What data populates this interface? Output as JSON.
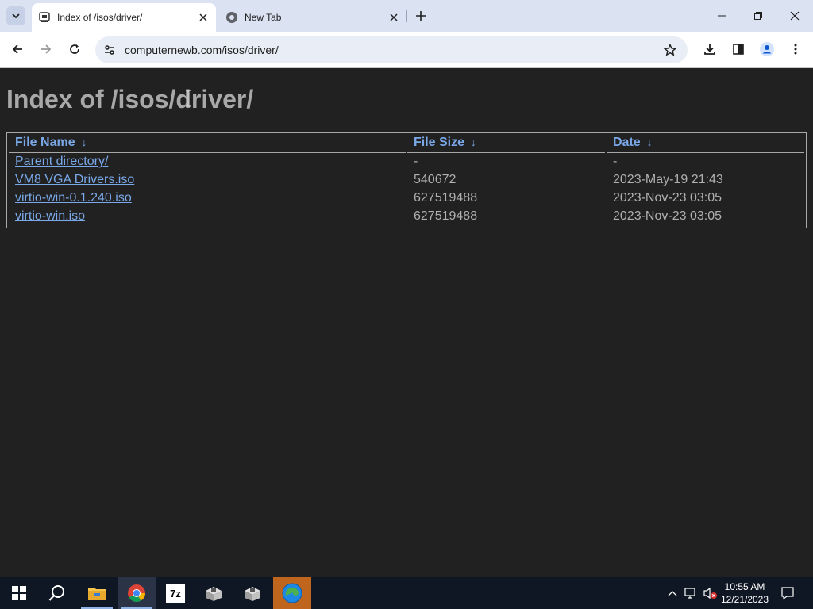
{
  "browser": {
    "tabs": [
      {
        "title": "Index of /isos/driver/",
        "active": true
      },
      {
        "title": "New Tab",
        "active": false
      }
    ],
    "url": "computernewb.com/isos/driver/"
  },
  "page": {
    "heading": "Index of /isos/driver/",
    "columns": [
      {
        "label": "File Name",
        "sort": "↓"
      },
      {
        "label": "File Size",
        "sort": "↓"
      },
      {
        "label": "Date",
        "sort": "↓"
      }
    ],
    "rows": [
      {
        "name": "Parent directory/",
        "size": "-",
        "date": "-"
      },
      {
        "name": "VM8 VGA Drivers.iso",
        "size": "540672",
        "date": "2023-May-19 21:43"
      },
      {
        "name": "virtio-win-0.1.240.iso",
        "size": "627519488",
        "date": "2023-Nov-23 03:05"
      },
      {
        "name": "virtio-win.iso",
        "size": "627519488",
        "date": "2023-Nov-23 03:05"
      }
    ]
  },
  "taskbar": {
    "apps": [
      "start",
      "search",
      "file-explorer",
      "chrome",
      "7-zip",
      "setup-app-1",
      "setup-app-2",
      "edge"
    ],
    "labels": {
      "sevenzip": "7z"
    },
    "time": "10:55 AM",
    "date": "12/21/2023"
  },
  "colors": {
    "page_bg": "#212121",
    "link": "#7aa8e8",
    "text": "#b0b0b0",
    "tabstrip": "#dbe3f3",
    "taskbar": "#0f1724"
  }
}
